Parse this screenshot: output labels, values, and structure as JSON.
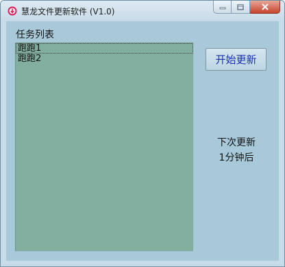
{
  "window": {
    "title": "慧龙文件更新软件 (V1.0)"
  },
  "task_list": {
    "label": "任务列表",
    "items": [
      "跑跑1",
      "跑跑2"
    ]
  },
  "buttons": {
    "start_update": "开始更新"
  },
  "status": {
    "line1": "下次更新",
    "line2": "1分钟后"
  },
  "icons": {
    "app": "download-arrow-icon",
    "minimize": "minimize-icon",
    "maximize": "maximize-icon",
    "close": "close-icon"
  },
  "colors": {
    "form_background": "#a8c9da",
    "list_background": "#82ae9f",
    "button_text": "#1a2fb0"
  }
}
